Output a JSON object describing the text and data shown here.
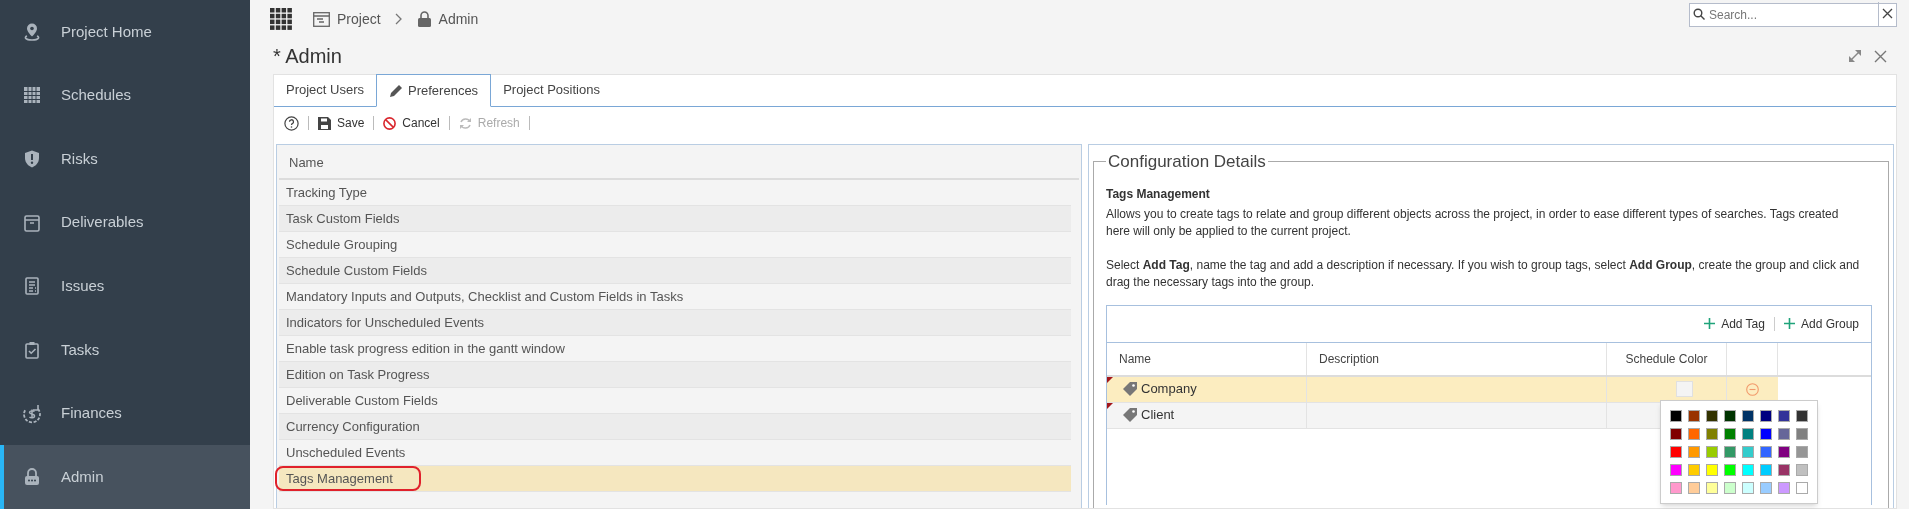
{
  "sidebar": {
    "items": [
      {
        "label": "Project Home",
        "selected": false
      },
      {
        "label": "Schedules",
        "selected": false
      },
      {
        "label": "Risks",
        "selected": false
      },
      {
        "label": "Deliverables",
        "selected": false
      },
      {
        "label": "Issues",
        "selected": false
      },
      {
        "label": "Tasks",
        "selected": false
      },
      {
        "label": "Finances",
        "selected": false
      },
      {
        "label": "Admin",
        "selected": true
      }
    ]
  },
  "breadcrumb": [
    "Project",
    "Admin"
  ],
  "search": {
    "placeholder": "Search..."
  },
  "page_title": "* Admin",
  "tabs": [
    {
      "label": "Project Users",
      "selected": false
    },
    {
      "label": "Preferences",
      "selected": true
    },
    {
      "label": "Project Positions",
      "selected": false
    }
  ],
  "toolbar": [
    {
      "label": "Save",
      "disabled": false
    },
    {
      "label": "Cancel",
      "disabled": false
    },
    {
      "label": "Refresh",
      "disabled": true
    }
  ],
  "preferences": {
    "column": "Name",
    "rows": [
      {
        "label": "Tracking Type",
        "selected": false
      },
      {
        "label": "Task Custom Fields",
        "selected": false
      },
      {
        "label": "Schedule Grouping",
        "selected": false
      },
      {
        "label": "Schedule Custom Fields",
        "selected": false
      },
      {
        "label": "Mandatory Inputs and Outputs, Checklist and Custom Fields in Tasks",
        "selected": false
      },
      {
        "label": "Indicators for Unscheduled Events",
        "selected": false
      },
      {
        "label": "Enable task progress edition in the gantt window",
        "selected": false
      },
      {
        "label": "Edition on Task Progress",
        "selected": false
      },
      {
        "label": "Deliverable Custom Fields",
        "selected": false
      },
      {
        "label": "Currency Configuration",
        "selected": false
      },
      {
        "label": "Unscheduled Events",
        "selected": false
      },
      {
        "label": "Tags Management",
        "selected": true
      }
    ]
  },
  "details": {
    "legend": "Configuration Details",
    "heading": "Tags Management",
    "paragraphs": [
      "Allows you to create tags to relate and group different objects across the project, in order to ease different types of searches. Tags created here will only be applied to the current project.",
      "Select **Add Tag**, name the tag and add a description if necessary.  If you wish to group tags, select **Add Group**, create the group and click and drag the necessary tags into the group."
    ],
    "tag_actions": [
      "Add Tag",
      "Add Group"
    ],
    "tag_columns": [
      "Name",
      "Description",
      "Schedule Color"
    ],
    "tags": [
      {
        "name": "Company",
        "selected": true
      },
      {
        "name": "Client",
        "selected": false
      }
    ],
    "palette": [
      {
        "color": "#000000"
      },
      {
        "color": "#993300"
      },
      {
        "color": "#333300"
      },
      {
        "color": "#003300"
      },
      {
        "color": "#003366"
      },
      {
        "color": "#000080"
      },
      {
        "color": "#333399"
      },
      {
        "color": "#333333"
      },
      {
        "color": "#800000"
      },
      {
        "color": "#ff6600"
      },
      {
        "color": "#808000"
      },
      {
        "color": "#008000"
      },
      {
        "color": "#008080"
      },
      {
        "color": "#0000ff"
      },
      {
        "color": "#666699"
      },
      {
        "color": "#808080"
      },
      {
        "color": "#ff0000"
      },
      {
        "color": "#ff9900"
      },
      {
        "color": "#99cc00"
      },
      {
        "color": "#339966"
      },
      {
        "color": "#33cccc"
      },
      {
        "color": "#3366ff"
      },
      {
        "color": "#800080"
      },
      {
        "color": "#969696"
      },
      {
        "color": "#ff00ff"
      },
      {
        "color": "#ffcc00"
      },
      {
        "color": "#ffff00"
      },
      {
        "color": "#00ff00"
      },
      {
        "color": "#00ffff"
      },
      {
        "color": "#00ccff"
      },
      {
        "color": "#993366"
      },
      {
        "color": "#c0c0c0"
      },
      {
        "color": "#ff99cc"
      },
      {
        "color": "#ffcc99"
      },
      {
        "color": "#ffff99"
      },
      {
        "color": "#ccffcc"
      },
      {
        "color": "#ccffff"
      },
      {
        "color": "#99ccff"
      },
      {
        "color": "#cc99ff"
      },
      {
        "color": "#ffffff"
      }
    ]
  }
}
